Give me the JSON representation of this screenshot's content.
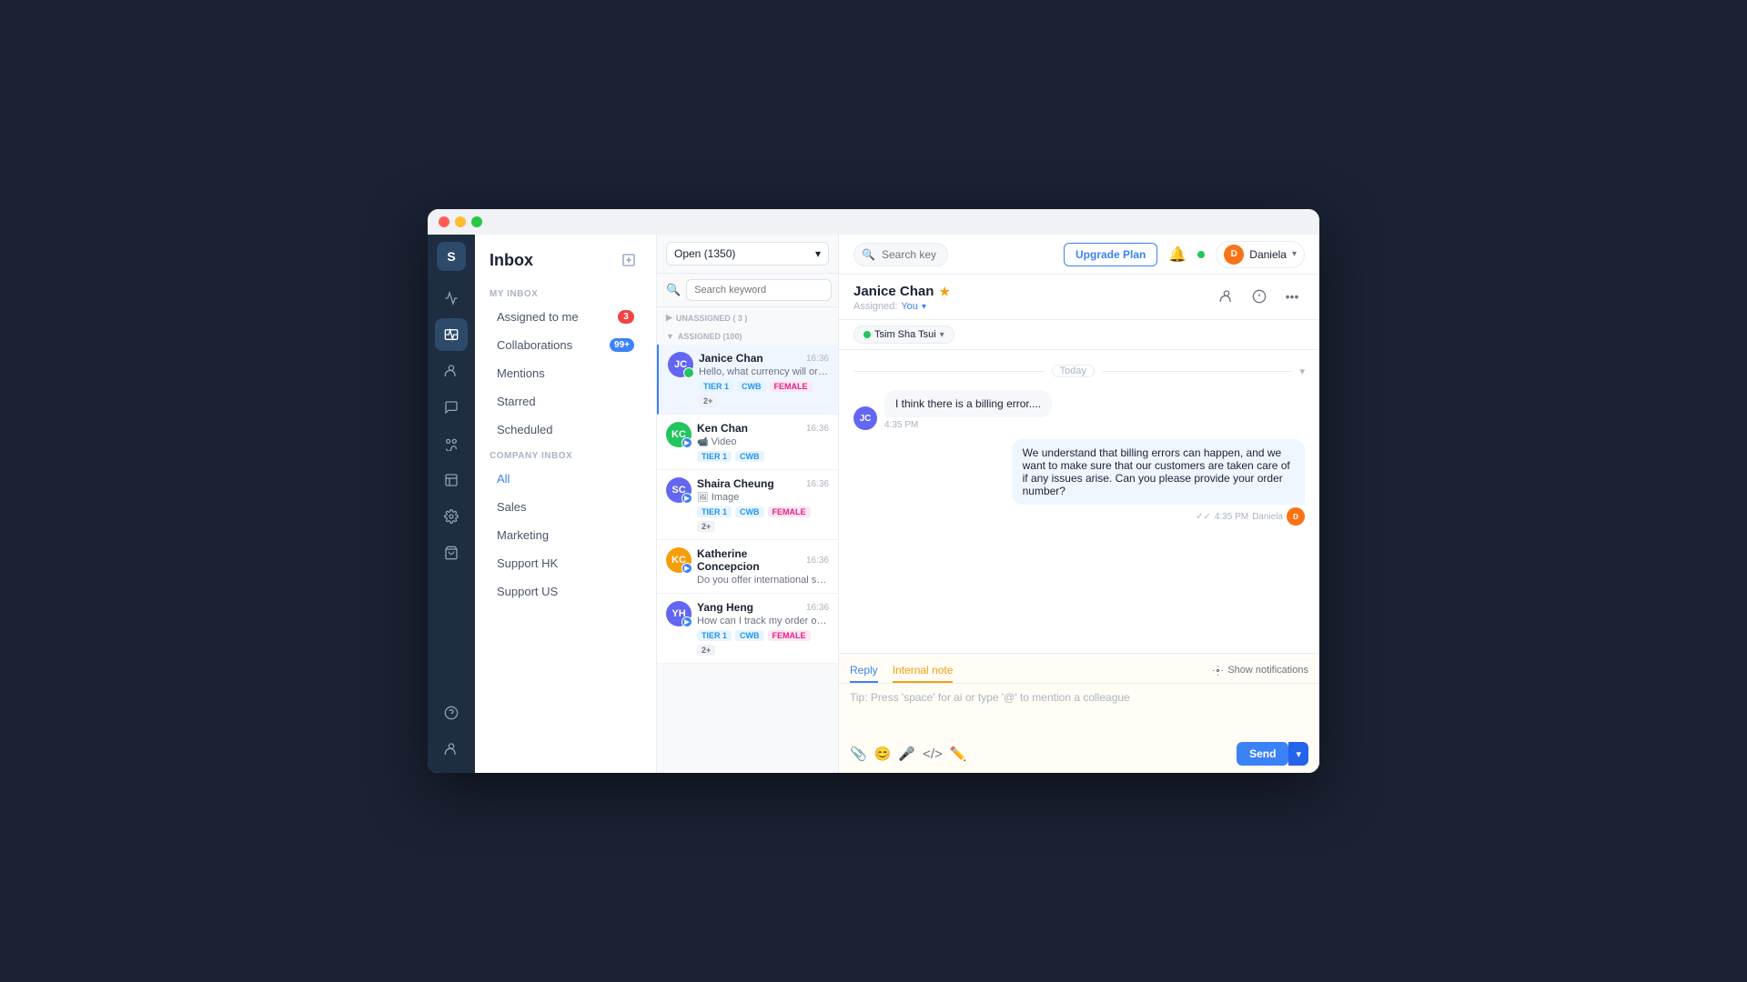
{
  "window": {
    "dots": [
      "red",
      "yellow",
      "green"
    ]
  },
  "header": {
    "search_placeholder": "Search keywords, contacts, numbers, etc...",
    "upgrade_btn": "Upgrade Plan",
    "user_name": "Daniela",
    "user_initials": "D"
  },
  "sidebar": {
    "title": "Inbox",
    "my_inbox_label": "MY INBOX",
    "company_inbox_label": "COMPANY INBOX",
    "items_my": [
      {
        "label": "Assigned to me",
        "badge": "3",
        "badge_type": "red"
      },
      {
        "label": "Collaborations",
        "badge": "99+",
        "badge_type": "blue"
      },
      {
        "label": "Mentions",
        "badge": null
      },
      {
        "label": "Starred",
        "badge": null
      },
      {
        "label": "Scheduled",
        "badge": null
      }
    ],
    "items_company": [
      {
        "label": "All",
        "active": true
      },
      {
        "label": "Sales"
      },
      {
        "label": "Marketing"
      },
      {
        "label": "Support HK"
      },
      {
        "label": "Support US"
      }
    ]
  },
  "conv_list": {
    "filter_label": "Open (1350)",
    "search_placeholder": "Search keyword",
    "group_unassigned": "UNASSIGNED ( 3 )",
    "group_assigned": "ASSIGNED (100)",
    "conversations": [
      {
        "name": "Janice Chan",
        "time": "16:36",
        "preview": "Hello, what currency will orders be settled in?",
        "tags": [
          "TIER 1",
          "CWB",
          "FEMALE",
          "2+"
        ],
        "avatar_color": "#6366f1",
        "avatar_initials": "JC",
        "active": true
      },
      {
        "name": "Ken Chan",
        "time": "16:36",
        "preview": "Video",
        "tags": [
          "TIER 1",
          "CWB"
        ],
        "avatar_color": "#22c55e",
        "avatar_initials": "KC",
        "active": false
      },
      {
        "name": "Shaira Cheung",
        "time": "16:36",
        "preview": "Image",
        "tags": [
          "TIER 1",
          "CWB",
          "FEMALE",
          "2+"
        ],
        "avatar_color": "#6366f1",
        "avatar_initials": "SC",
        "active": false
      },
      {
        "name": "Katherine Concepcion",
        "time": "16:36",
        "preview": "Do you offer international shipping?",
        "tags": [],
        "avatar_color": "#f59e0b",
        "avatar_initials": "KC",
        "active": false
      },
      {
        "name": "Yang Heng",
        "time": "16:36",
        "preview": "How can I track my order once it has been shipped?",
        "tags": [
          "TIER 1",
          "CWB",
          "FEMALE",
          "2+"
        ],
        "avatar_color": "#6366f1",
        "avatar_initials": "YH",
        "active": false
      }
    ]
  },
  "chat": {
    "contact_name": "Janice Chan",
    "assigned_label": "Assigned:",
    "assigned_to": "You",
    "channel": "Tsim Sha Tsui",
    "date_label": "Today",
    "messages": [
      {
        "type": "incoming",
        "text": "I think there is a billing error....",
        "time": "4:35 PM",
        "avatar_color": "#6366f1",
        "avatar_initials": "JC"
      },
      {
        "type": "outgoing",
        "text": "We understand that billing errors can happen, and we want to make sure that our customers are taken care of if any issues arise. Can you please provide your order number?",
        "time": "4:35 PM",
        "sender": "Daniela",
        "sender_initials": "D"
      }
    ],
    "reply_tab": "Reply",
    "internal_note_tab": "Internal note",
    "show_notif_label": "Show notifications",
    "reply_placeholder": "Tip: Press 'space' for ai or type '@' to mention a colleague",
    "send_label": "Send"
  }
}
